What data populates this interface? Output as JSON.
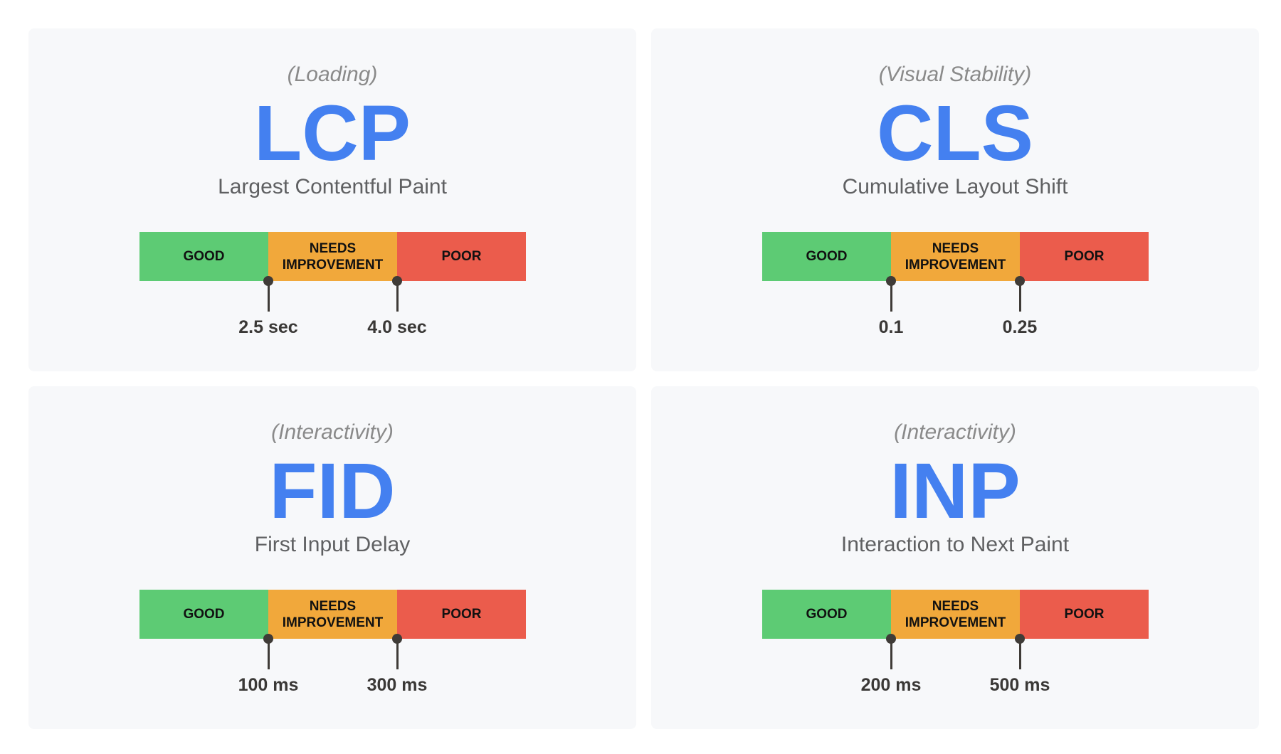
{
  "segments": {
    "good": "GOOD",
    "needs_improvement": "NEEDS IMPROVEMENT",
    "poor": "POOR"
  },
  "colors": {
    "good": "#5dcb74",
    "needs_improvement": "#f1a83b",
    "poor": "#eb5c4c",
    "accent": "#4480f0"
  },
  "metrics": [
    {
      "category": "(Loading)",
      "abbr": "LCP",
      "name": "Largest Contentful Paint",
      "threshold_1": "2.5 sec",
      "threshold_2": "4.0 sec"
    },
    {
      "category": "(Visual Stability)",
      "abbr": "CLS",
      "name": "Cumulative Layout Shift",
      "threshold_1": "0.1",
      "threshold_2": "0.25"
    },
    {
      "category": "(Interactivity)",
      "abbr": "FID",
      "name": "First Input Delay",
      "threshold_1": "100 ms",
      "threshold_2": "300 ms"
    },
    {
      "category": "(Interactivity)",
      "abbr": "INP",
      "name": "Interaction to Next Paint",
      "threshold_1": "200 ms",
      "threshold_2": "500 ms"
    }
  ]
}
